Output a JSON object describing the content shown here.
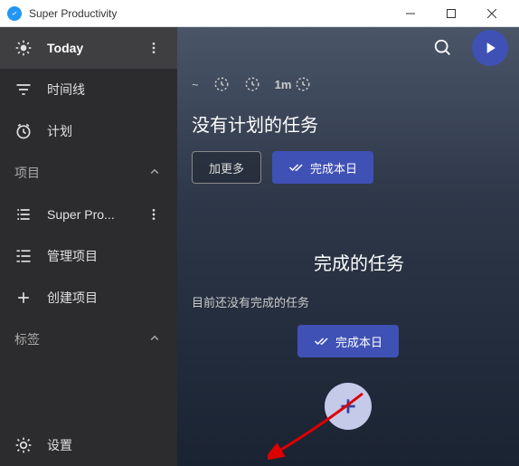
{
  "titlebar": {
    "title": "Super Productivity"
  },
  "sidebar": {
    "today": "Today",
    "timeline": "时间线",
    "plan": "计划",
    "projectSection": "项目",
    "projectItem": "Super Pro...",
    "manageProjects": "管理项目",
    "createProject": "创建项目",
    "tagsSection": "标签",
    "settings": "设置"
  },
  "main": {
    "stats": {
      "timer": "1m"
    },
    "noPlannedTasks": "没有计划的任务",
    "addMore": "加更多",
    "finishDay": "完成本日",
    "completedTasks": "完成的任务",
    "noCompletedYet": "目前还没有完成的任务"
  }
}
